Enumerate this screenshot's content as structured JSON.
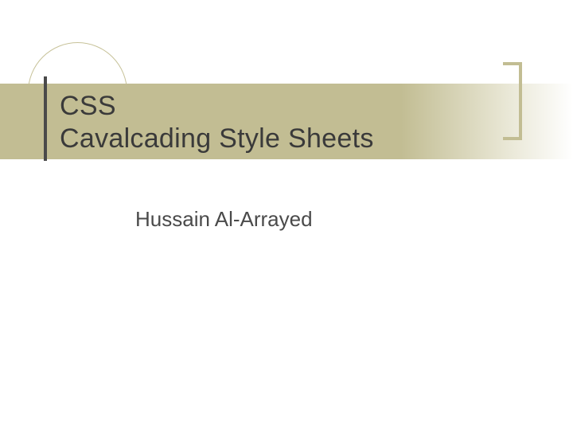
{
  "slide": {
    "title_line1": "CSS",
    "title_line2": "Cavalcading Style Sheets",
    "author": "Hussain Al-Arrayed",
    "colors": {
      "band": "#c2bd93",
      "text": "#3a3a3a",
      "accent_line": "#4a4a4a"
    }
  }
}
